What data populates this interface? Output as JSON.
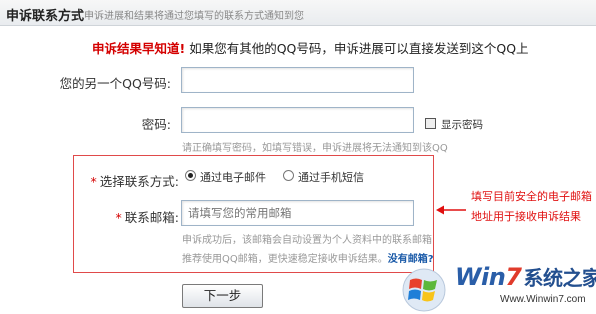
{
  "header": {
    "title": "申诉联系方式",
    "desc": "申诉进展和结果将通过您填写的联系方式通知到您"
  },
  "notice": {
    "highlight": "申诉结果早知道!",
    "text": "如果您有其他的QQ号码，申诉进展可以直接发送到这个QQ上"
  },
  "form": {
    "other_qq_label": "您的另一个QQ号码:",
    "other_qq_value": "",
    "password_label": "密码:",
    "password_value": "",
    "show_password_label": "显示密码",
    "password_hint": "请正确填写密码，如填写错误，申诉进展将无法通知到该QQ",
    "contact_method_label": "选择联系方式:",
    "method_email": "通过电子邮件",
    "method_sms": "通过手机短信",
    "email_label": "联系邮箱:",
    "email_placeholder": "请填写您的常用邮箱",
    "email_hint_1": "申诉成功后，该邮箱会自动设置为个人资料中的联系邮箱",
    "email_hint_2": "推荐使用QQ邮箱，更快速稳定接收申诉结果。",
    "no_mailbox_link": "没有邮箱?",
    "required_mark": "*"
  },
  "next_button": "下一步",
  "annotation": {
    "line1": "填写目前安全的电子邮箱",
    "line2": "地址用于接收申诉结果"
  },
  "watermark": {
    "brand_prefix": "Win",
    "brand_seven": "7",
    "brand_cn": "系统之家",
    "url": "Www.Winwin7.com"
  },
  "colors": {
    "accent_red": "#d40000",
    "frame_red": "#e04a4a",
    "link_blue": "#1a5aa8"
  }
}
